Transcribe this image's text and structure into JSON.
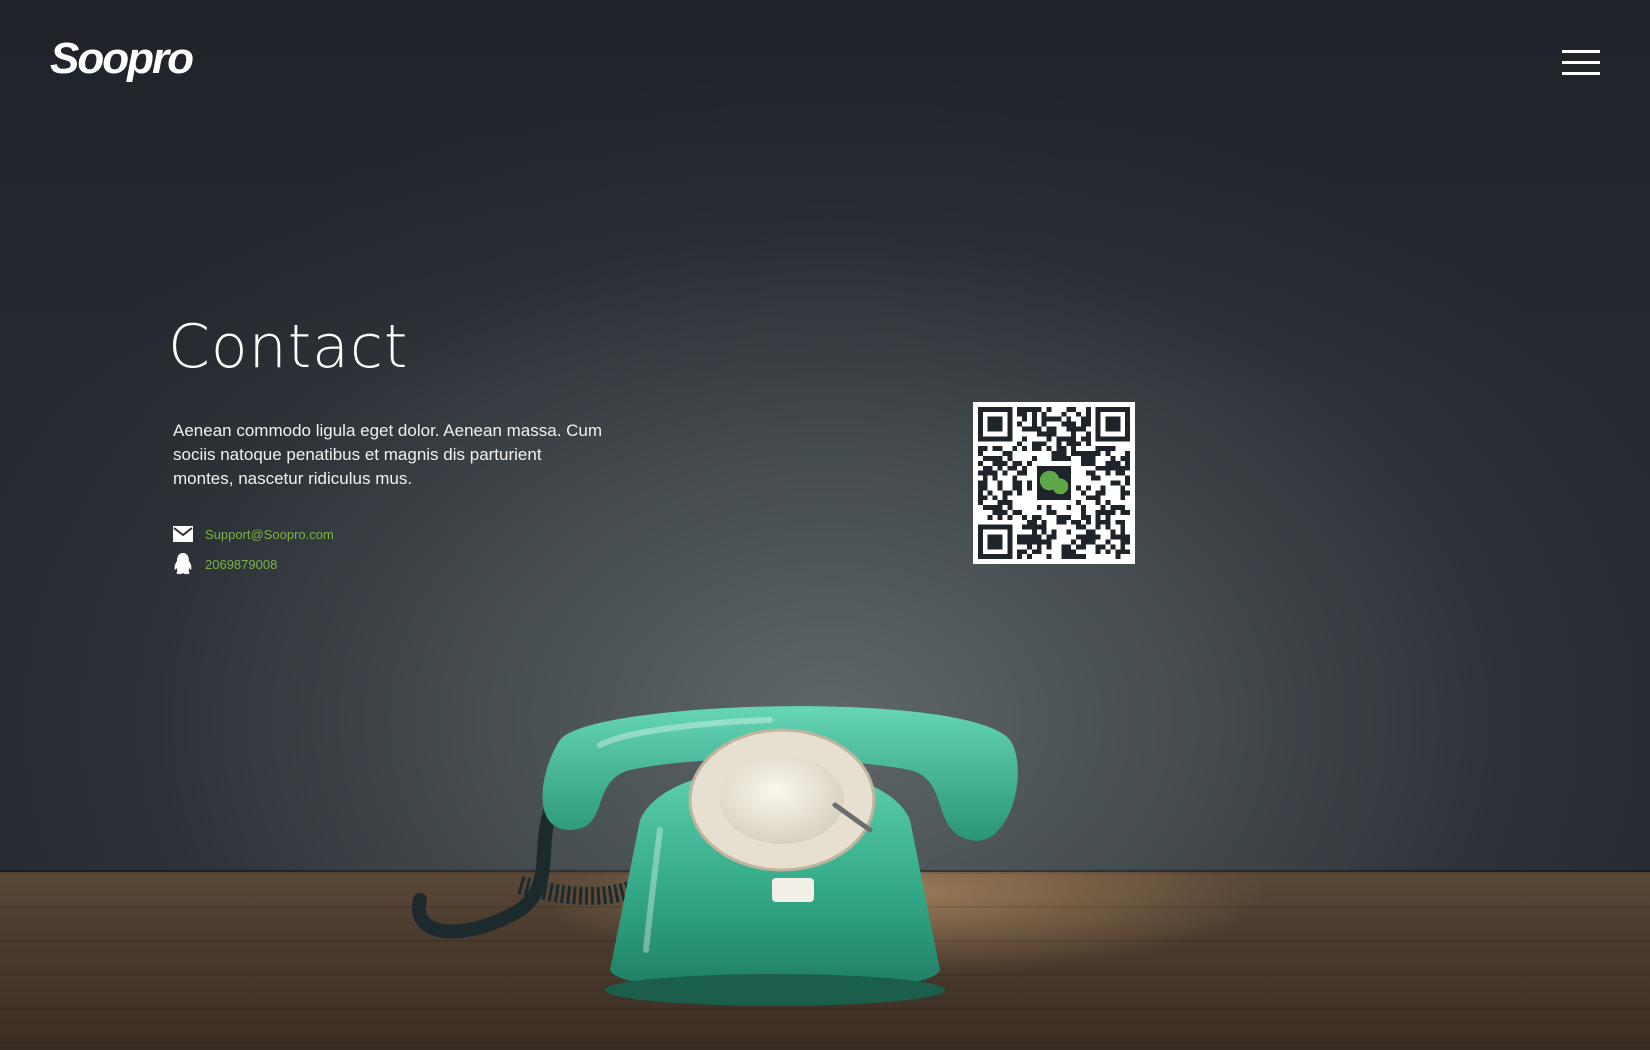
{
  "brand": {
    "logo_text": "Soopro"
  },
  "header": {
    "menu_icon": "hamburger-menu-icon"
  },
  "contact": {
    "title": "Contact",
    "description": "Aenean commodo ligula eget dolor. Aenean massa. Cum sociis natoque penatibus et magnis dis parturient montes, nascetur ridiculus mus.",
    "email": {
      "icon": "envelope-icon",
      "value": "Support@Soopro.com"
    },
    "qq": {
      "icon": "qq-penguin-icon",
      "value": "2069879008"
    },
    "qr": {
      "icon": "wechat-icon"
    }
  },
  "colors": {
    "link_green": "#7cb342",
    "wechat_green": "#5fa84a",
    "phone_teal": "#3fae8e"
  }
}
